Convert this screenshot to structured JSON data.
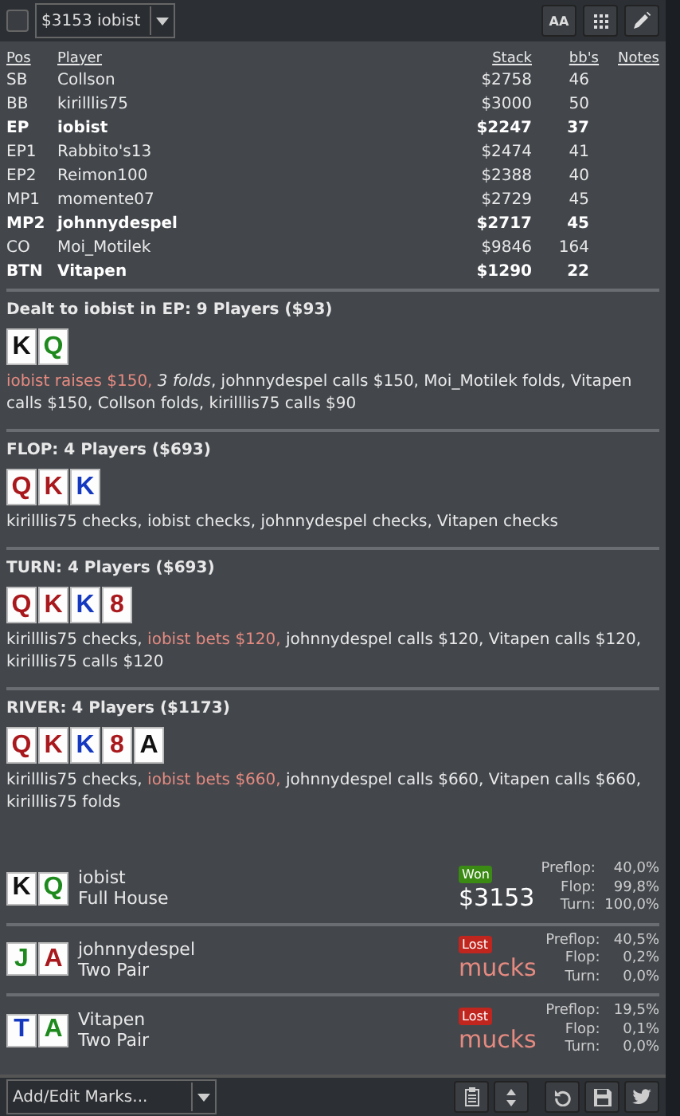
{
  "toolbar": {
    "checkbox": {
      "checked": false
    },
    "hand_select": {
      "value": "$3153 iobist"
    },
    "font_button": "AA"
  },
  "players_table": {
    "columns": [
      "Pos",
      "Player",
      "Stack",
      "bb's",
      "Notes"
    ],
    "rows": [
      {
        "pos": "SB",
        "player": "Collson",
        "stack": "$2758",
        "bbs": "46",
        "highlighted": false
      },
      {
        "pos": "BB",
        "player": "kirilllis75",
        "stack": "$3000",
        "bbs": "50",
        "highlighted": false
      },
      {
        "pos": "EP",
        "player": "iobist",
        "stack": "$2247",
        "bbs": "37",
        "highlighted": true
      },
      {
        "pos": "EP1",
        "player": "Rabbito's13",
        "stack": "$2474",
        "bbs": "41",
        "highlighted": false
      },
      {
        "pos": "EP2",
        "player": "Reimon100",
        "stack": "$2388",
        "bbs": "40",
        "highlighted": false
      },
      {
        "pos": "MP1",
        "player": "momente07",
        "stack": "$2729",
        "bbs": "45",
        "highlighted": false
      },
      {
        "pos": "MP2",
        "player": "johnnydespel",
        "stack": "$2717",
        "bbs": "45",
        "highlighted": true
      },
      {
        "pos": "CO",
        "player": "Moi_Motilek",
        "stack": "$9846",
        "bbs": "164",
        "highlighted": false
      },
      {
        "pos": "BTN",
        "player": "Vitapen",
        "stack": "$1290",
        "bbs": "22",
        "highlighted": true
      }
    ]
  },
  "streets": [
    {
      "title": "Dealt to iobist in EP: 9 Players ($93)",
      "cards": [
        {
          "rank": "K",
          "color": "#111111"
        },
        {
          "rank": "Q",
          "color": "#1e8a1e"
        }
      ],
      "actions": [
        {
          "text": "iobist raises $150,",
          "kind": "hero"
        },
        {
          "text": "3 folds",
          "kind": "summary"
        },
        {
          "text": ", johnnydespel calls $150, Moi_Motilek folds, Vitapen calls $150, Collson folds, kirilllis75 calls $90",
          "kind": "plain"
        }
      ]
    },
    {
      "title": "FLOP: 4 Players ($693)",
      "cards": [
        {
          "rank": "Q",
          "color": "#a8181c"
        },
        {
          "rank": "K",
          "color": "#a8181c"
        },
        {
          "rank": "K",
          "color": "#1438c0"
        }
      ],
      "actions": [
        {
          "text": "kirilllis75 checks, iobist checks, johnnydespel checks, Vitapen checks",
          "kind": "plain"
        }
      ]
    },
    {
      "title": "TURN: 4 Players ($693)",
      "cards": [
        {
          "rank": "Q",
          "color": "#a8181c"
        },
        {
          "rank": "K",
          "color": "#a8181c"
        },
        {
          "rank": "K",
          "color": "#1438c0"
        },
        {
          "rank": "8",
          "color": "#a8181c"
        }
      ],
      "actions": [
        {
          "text": "kirilllis75 checks,",
          "kind": "plain"
        },
        {
          "text": "iobist bets $120,",
          "kind": "hero"
        },
        {
          "text": "johnnydespel calls $120, Vitapen calls $120, kirilllis75 calls $120",
          "kind": "plain"
        }
      ]
    },
    {
      "title": "RIVER: 4 Players ($1173)",
      "cards": [
        {
          "rank": "Q",
          "color": "#a8181c"
        },
        {
          "rank": "K",
          "color": "#a8181c"
        },
        {
          "rank": "K",
          "color": "#1438c0"
        },
        {
          "rank": "8",
          "color": "#a8181c"
        },
        {
          "rank": "A",
          "color": "#111111"
        }
      ],
      "actions": [
        {
          "text": "kirilllis75 checks,",
          "kind": "plain"
        },
        {
          "text": "iobist bets $660,",
          "kind": "hero"
        },
        {
          "text": "johnnydespel calls $660, Vitapen calls $660, kirilllis75 folds",
          "kind": "plain"
        }
      ]
    }
  ],
  "results": [
    {
      "cards": [
        {
          "rank": "K",
          "color": "#111111"
        },
        {
          "rank": "Q",
          "color": "#1e8a1e"
        }
      ],
      "player": "iobist",
      "hand": "Full House",
      "outcome": {
        "kind": "won",
        "label": "Won"
      },
      "amount": "$3153",
      "equity": [
        {
          "street": "Preflop:",
          "value": "40,0%"
        },
        {
          "street": "Flop:",
          "value": "99,8%"
        },
        {
          "street": "Turn:",
          "value": "100,0%"
        }
      ]
    },
    {
      "cards": [
        {
          "rank": "J",
          "color": "#1e8a1e"
        },
        {
          "rank": "A",
          "color": "#a8181c"
        }
      ],
      "player": "johnnydespel",
      "hand": "Two Pair",
      "outcome": {
        "kind": "lost",
        "label": "Lost"
      },
      "amount": "mucks",
      "equity": [
        {
          "street": "Preflop:",
          "value": "40,5%"
        },
        {
          "street": "Flop:",
          "value": "0,2%"
        },
        {
          "street": "Turn:",
          "value": "0,0%"
        }
      ]
    },
    {
      "cards": [
        {
          "rank": "T",
          "color": "#1438c0"
        },
        {
          "rank": "A",
          "color": "#1e8a1e"
        }
      ],
      "player": "Vitapen",
      "hand": "Two Pair",
      "outcome": {
        "kind": "lost",
        "label": "Lost"
      },
      "amount": "mucks",
      "equity": [
        {
          "street": "Preflop:",
          "value": "19,5%"
        },
        {
          "street": "Flop:",
          "value": "0,1%"
        },
        {
          "street": "Turn:",
          "value": "0,0%"
        }
      ]
    }
  ],
  "footer": {
    "marks_select": {
      "label": "Add/Edit Marks..."
    }
  }
}
